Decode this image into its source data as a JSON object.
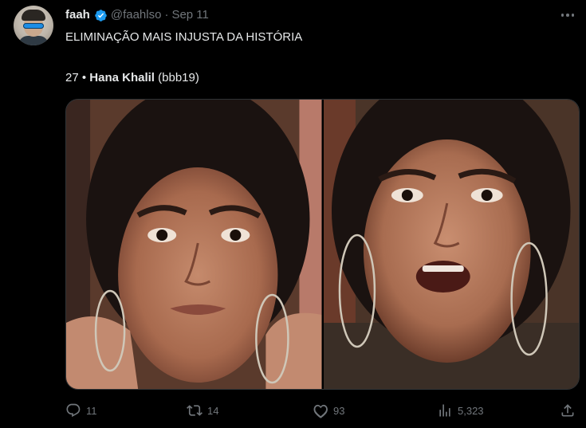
{
  "tweet": {
    "author": {
      "name": "faah",
      "handle": "@faahlso",
      "separator": "·",
      "date": "Sep 11",
      "verified": true
    },
    "text_line1": "ELIMINAÇÃO MAIS INJUSTA DA HISTÓRIA",
    "text_line2": {
      "prefix": "27 • ",
      "bold": "Hana Khalil",
      "suffix": " (bbb19)"
    },
    "media": {
      "image_count": 2
    },
    "metrics": {
      "replies": "11",
      "retweets": "14",
      "likes": "93",
      "views": "5,323"
    }
  },
  "colors": {
    "background": "#000000",
    "text": "#e7e9ea",
    "muted": "#71767b",
    "verified": "#1d9bf0"
  },
  "icons": {
    "verified": "verified-badge-icon",
    "more": "more-options-icon",
    "reply": "reply-icon",
    "retweet": "retweet-icon",
    "like": "heart-icon",
    "views": "views-chart-icon",
    "share": "share-icon"
  }
}
